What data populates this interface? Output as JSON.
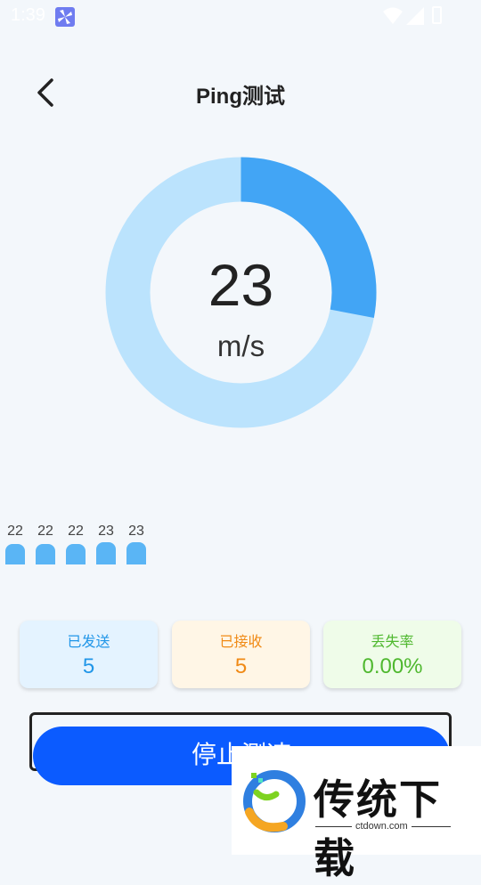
{
  "status_bar": {
    "time": "1:39"
  },
  "header": {
    "title": "Ping测试"
  },
  "gauge": {
    "value": "23",
    "unit": "m/s",
    "fill_fraction": 0.28,
    "fill_color": "#42a5f5",
    "track_color": "#bbe3fd"
  },
  "history": [
    {
      "label": "22",
      "level": 0.64
    },
    {
      "label": "22",
      "level": 0.64
    },
    {
      "label": "22",
      "level": 0.64
    },
    {
      "label": "23",
      "level": 0.7
    },
    {
      "label": "23",
      "level": 0.7
    }
  ],
  "stats": {
    "sent": {
      "label": "已发送",
      "value": "5"
    },
    "received": {
      "label": "已接收",
      "value": "5"
    },
    "loss": {
      "label": "丢失率",
      "value": "0.00%"
    }
  },
  "actions": {
    "stop_label": "停止测速"
  },
  "watermark": {
    "brand": "传统下载",
    "url": "ctdown.com"
  }
}
